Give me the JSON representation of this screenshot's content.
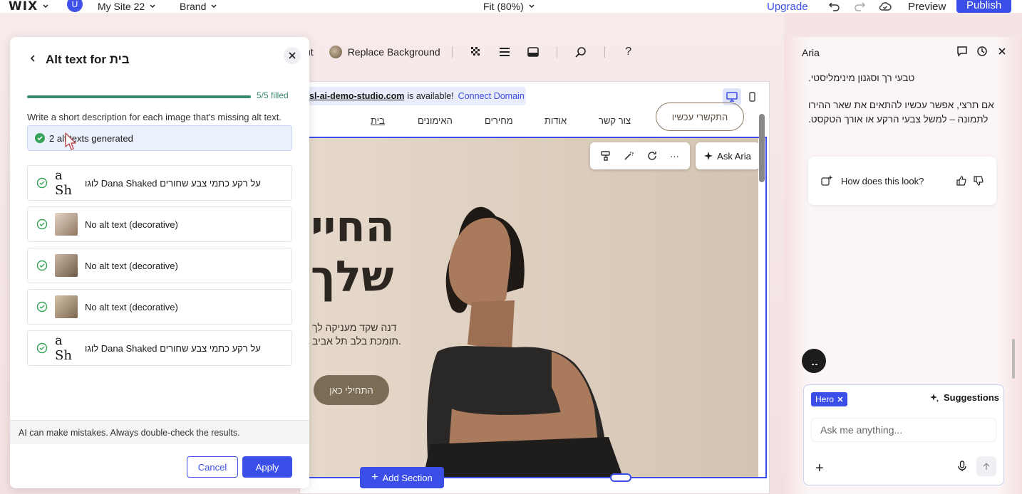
{
  "topbar": {
    "logo": "WIX",
    "avatar_initial": "U",
    "site_name": "My Site 22",
    "brand": "Brand",
    "zoom": "Fit (80%)",
    "upgrade": "Upgrade",
    "preview": "Preview",
    "publish": "Publish"
  },
  "tools": {
    "cut_label": "ut",
    "replace_bg": "Replace Background",
    "help": "?"
  },
  "domain_bar": {
    "domain": "sl-ai-demo-studio.com",
    "available": "is available!",
    "connect": "Connect Domain"
  },
  "site": {
    "nav": [
      "בית",
      "האימונים",
      "מחירים",
      "אודות",
      "צור קשר"
    ],
    "contact_button": "התקשרי עכשיו",
    "hero_title_line1": "החיי",
    "hero_title_line2": "שלך",
    "hero_sub_line1": "דנה שקד מעניקה לך",
    "hero_sub_line2": "תומכת בלב תל אביב.",
    "hero_cta": "התחילי כאן"
  },
  "floating": {
    "more": "···",
    "ask_aria": "Ask Aria"
  },
  "add_section": "Add Section",
  "alt_panel": {
    "title": "Alt text for בית",
    "progress_text": "5/5 filled",
    "progress_percent": 100,
    "instructions": "Write a short description for each image that's missing alt text.",
    "banner": "2 alt texts generated",
    "rows": [
      {
        "thumb": "logo",
        "thumb_text": "a Sh",
        "text": "לוגו Dana Shaked על רקע כתמי צבע שחורים"
      },
      {
        "thumb": "photo",
        "thumb_text": "",
        "text": "No alt text (decorative)"
      },
      {
        "thumb": "photo",
        "thumb_text": "",
        "text": "No alt text (decorative)"
      },
      {
        "thumb": "photo",
        "thumb_text": "",
        "text": "No alt text (decorative)"
      },
      {
        "thumb": "logo",
        "thumb_text": "a Sh",
        "text": "לוגו Dana Shaked על רקע כתמי צבע שחורים"
      }
    ],
    "disclaimer": "AI can make mistakes. Always double-check the results.",
    "cancel": "Cancel",
    "apply": "Apply"
  },
  "aria": {
    "title": "Aria",
    "message_line_top": "טבעי רך וסגנון מינימליסטי.",
    "message_para": "אם תרצי, אפשר עכשיו להתאים את שאר ההירו לתמונה – למשל צבעי הרקע או אורך הטקסט.",
    "feedback": "How does this look?",
    "chip": "Hero",
    "suggestions": "Suggestions",
    "input_placeholder": "Ask me anything...",
    "plus": "+"
  },
  "colors": {
    "accent": "#3b4ee8",
    "success": "#3d8a6a"
  }
}
